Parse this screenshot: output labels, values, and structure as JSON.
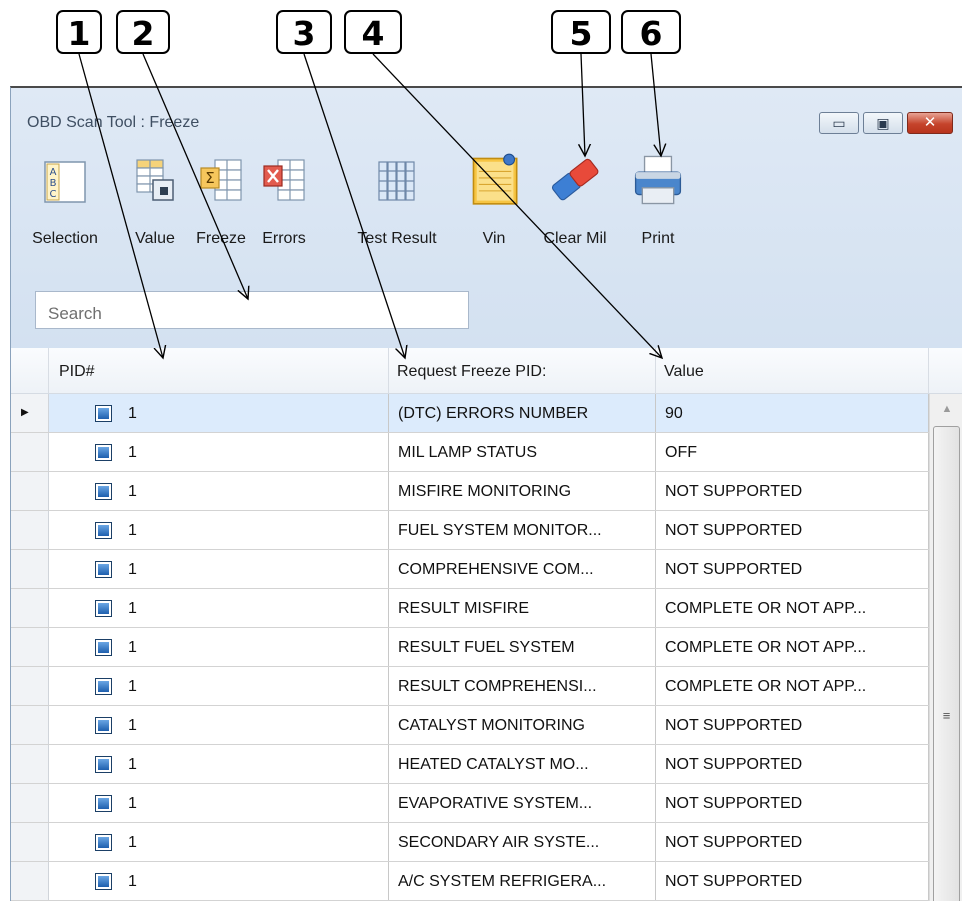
{
  "callouts": [
    "1",
    "2",
    "3",
    "4",
    "5",
    "6"
  ],
  "window": {
    "title": "OBD Scan Tool : Freeze",
    "controls": {
      "minimize": "▭",
      "maximize": "▣",
      "close": "✕"
    }
  },
  "toolbar": [
    {
      "label": "Selection",
      "icon": "abc-selection-icon"
    },
    {
      "label": "Value",
      "icon": "value-grid-icon"
    },
    {
      "label": "Freeze",
      "icon": "freeze-sigma-icon"
    },
    {
      "label": "Errors",
      "icon": "errors-x-icon"
    },
    {
      "label": "Test Result",
      "icon": "test-result-columns-icon"
    },
    {
      "label": "Vin",
      "icon": "notepad-pin-icon"
    },
    {
      "label": "Clear Mil",
      "icon": "eraser-icon"
    },
    {
      "label": "Print",
      "icon": "printer-icon"
    }
  ],
  "search": {
    "placeholder": "Search"
  },
  "grid": {
    "columns": [
      "PID#",
      "Request Freeze PID:",
      "Value"
    ],
    "rows": [
      {
        "pid": "1",
        "request": "(DTC) ERRORS NUMBER",
        "value": "90"
      },
      {
        "pid": "1",
        "request": "MIL LAMP STATUS",
        "value": "OFF"
      },
      {
        "pid": "1",
        "request": "MISFIRE MONITORING",
        "value": "NOT SUPPORTED"
      },
      {
        "pid": "1",
        "request": "FUEL SYSTEM MONITOR...",
        "value": "NOT SUPPORTED"
      },
      {
        "pid": "1",
        "request": "COMPREHENSIVE COM...",
        "value": "NOT SUPPORTED"
      },
      {
        "pid": "1",
        "request": "RESULT MISFIRE",
        "value": "COMPLETE OR NOT APP..."
      },
      {
        "pid": "1",
        "request": "RESULT FUEL SYSTEM",
        "value": "COMPLETE OR NOT APP..."
      },
      {
        "pid": "1",
        "request": "RESULT COMPREHENSI...",
        "value": "COMPLETE OR NOT APP..."
      },
      {
        "pid": "1",
        "request": "CATALYST MONITORING",
        "value": "NOT SUPPORTED"
      },
      {
        "pid": "1",
        "request": "HEATED CATALYST MO...",
        "value": "NOT SUPPORTED"
      },
      {
        "pid": "1",
        "request": "EVAPORATIVE SYSTEM...",
        "value": "NOT SUPPORTED"
      },
      {
        "pid": "1",
        "request": "SECONDARY AIR SYSTE...",
        "value": "NOT SUPPORTED"
      },
      {
        "pid": "1",
        "request": "A/C SYSTEM REFRIGERA...",
        "value": "NOT SUPPORTED"
      }
    ],
    "selected_row": 0
  },
  "colors": {
    "title_bar": "#dfe9f5",
    "selected_row": "#dcebfc",
    "close_button": "#c5442c"
  }
}
